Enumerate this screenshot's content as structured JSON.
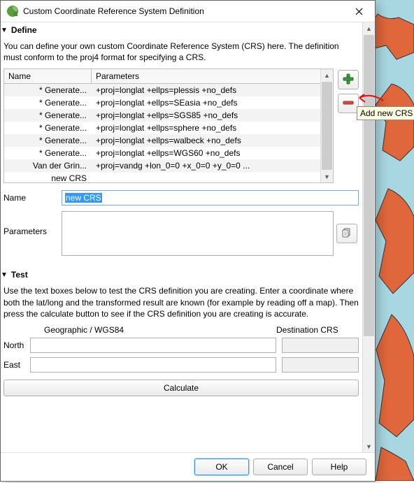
{
  "window": {
    "title": "Custom Coordinate Reference System Definition"
  },
  "define": {
    "header": "Define",
    "help": "You can define your own custom Coordinate Reference System (CRS) here. The definition must conform to the proj4 format for specifying a CRS.",
    "columns": {
      "name": "Name",
      "params": "Parameters"
    },
    "rows": [
      {
        "name": "* Generate...",
        "params": "+proj=longlat +ellps=plessis +no_defs"
      },
      {
        "name": "* Generate...",
        "params": "+proj=longlat +ellps=SEasia +no_defs"
      },
      {
        "name": "* Generate...",
        "params": "+proj=longlat +ellps=SGS85 +no_defs"
      },
      {
        "name": "* Generate...",
        "params": "+proj=longlat +ellps=sphere +no_defs"
      },
      {
        "name": "* Generate...",
        "params": "+proj=longlat +ellps=walbeck +no_defs"
      },
      {
        "name": "* Generate...",
        "params": "+proj=longlat +ellps=WGS60 +no_defs"
      },
      {
        "name": "Van der Grin...",
        "params": "+proj=vandg +lon_0=0 +x_0=0 +y_0=0 ..."
      },
      {
        "name": "new CRS",
        "params": ""
      }
    ],
    "name_label": "Name",
    "name_value": "new CRS",
    "param_label": "Parameters",
    "icons": {
      "add": "plus-icon",
      "remove": "minus-icon",
      "copy": "copy-icon"
    },
    "tooltip_add": "Add new CRS"
  },
  "test": {
    "header": "Test",
    "help": "Use the text boxes below to test the CRS definition you are creating. Enter a coordinate where both the lat/long and the transformed result are known (for example by reading off a map). Then press the calculate button to see if the CRS definition you are creating is accurate.",
    "col_geo": "Geographic / WGS84",
    "col_dst": "Destination CRS",
    "north_label": "North",
    "east_label": "East",
    "calculate": "Calculate"
  },
  "buttons": {
    "ok": "OK",
    "cancel": "Cancel",
    "help": "Help"
  }
}
